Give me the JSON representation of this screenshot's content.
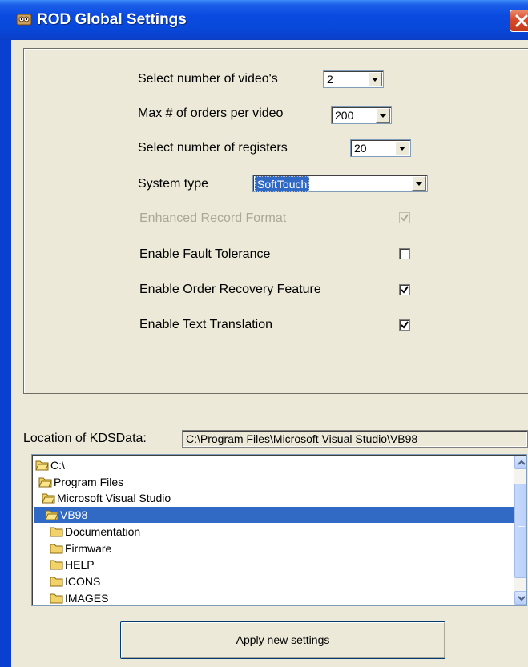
{
  "window": {
    "title": "ROD Global Settings",
    "app_icon": "rod-app-icon",
    "close_icon": "close-icon",
    "colors": {
      "titlebar": "#0a4ae0",
      "face": "#ece9d8",
      "selection": "#316ac5",
      "close": "#d7492a"
    }
  },
  "settings": {
    "videos_label": "Select number of video's",
    "videos_value": "2",
    "orders_label": "Max # of orders per video",
    "orders_value": "200",
    "registers_label": "Select number of registers",
    "registers_value": "20",
    "system_type_label": "System type",
    "system_type_value": "SoftTouch",
    "checkboxes": [
      {
        "label": "Enhanced Record Format",
        "checked": true,
        "disabled": true
      },
      {
        "label": "Enable Fault Tolerance",
        "checked": false,
        "disabled": false
      },
      {
        "label": "Enable Order Recovery Feature",
        "checked": true,
        "disabled": false
      },
      {
        "label": "Enable Text Translation",
        "checked": true,
        "disabled": false
      }
    ]
  },
  "location": {
    "label": "Location of KDSData:",
    "path": "C:\\Program Files\\Microsoft Visual Studio\\VB98"
  },
  "tree": {
    "items": [
      {
        "label": "C:\\",
        "icon": "open-folder-icon",
        "selected": false
      },
      {
        "label": "Program Files",
        "icon": "open-folder-icon",
        "selected": false
      },
      {
        "label": "Microsoft Visual Studio",
        "icon": "open-folder-icon",
        "selected": false
      },
      {
        "label": "VB98",
        "icon": "open-folder-icon",
        "selected": true
      },
      {
        "label": "Documentation",
        "icon": "folder-icon",
        "selected": false
      },
      {
        "label": "Firmware",
        "icon": "folder-icon",
        "selected": false
      },
      {
        "label": "HELP",
        "icon": "folder-icon",
        "selected": false
      },
      {
        "label": "ICONS",
        "icon": "folder-icon",
        "selected": false
      },
      {
        "label": "IMAGES",
        "icon": "folder-icon",
        "selected": false
      }
    ]
  },
  "apply_button": {
    "label": "Apply new settings"
  }
}
